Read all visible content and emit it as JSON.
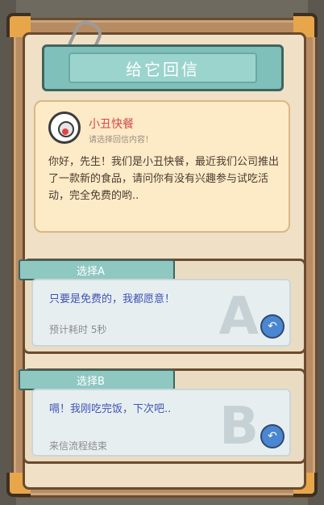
{
  "title": "给它回信",
  "letter": {
    "sender": "小丑快餐",
    "hint": "请选择回信内容！",
    "body": "你好，先生！我们是小丑快餐，最近我们公司推出了一款新的食品，请问你有没有兴趣参与试吃活动，完全免费的哟.."
  },
  "options": [
    {
      "label": "选择A",
      "letter": "A",
      "text": "只要是免费的，我都愿意！",
      "footer": "预计耗时 5秒"
    },
    {
      "label": "选择B",
      "letter": "B",
      "text": "嗝！我刚吃完饭，下次吧..",
      "footer": "来信流程结束"
    }
  ],
  "colors": {
    "accent": "#7fc0ba",
    "sender": "#d24a4a",
    "choice": "#3f53b5"
  },
  "icons": {
    "reply": "reply-arrow-icon",
    "avatar": "clown-avatar"
  }
}
